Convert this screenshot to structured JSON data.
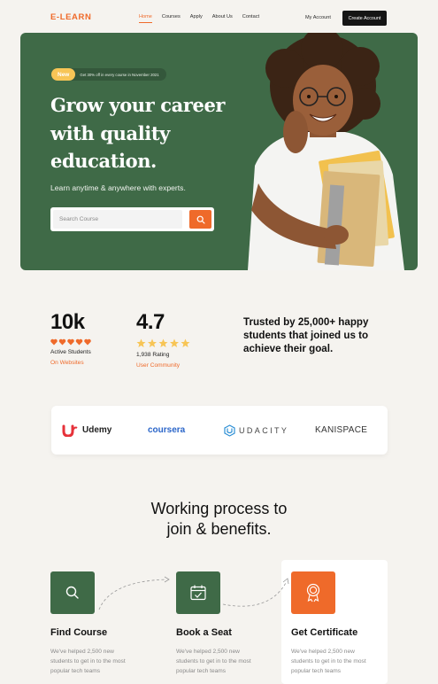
{
  "nav": {
    "logo": "E-LEARN",
    "links": [
      "Home",
      "Courses",
      "Apply",
      "About Us",
      "Contact"
    ],
    "my_account": "My Account",
    "create_account": "Create Account"
  },
  "hero": {
    "promo_badge": "New",
    "promo_text": "Get 30% off in every course in November 2021",
    "title_lines": [
      "Grow your career",
      "with quality",
      "education."
    ],
    "subtitle": "Learn anytime & anywhere with experts.",
    "search_placeholder": "Search Course",
    "background_color": "#3f6a47"
  },
  "stats": [
    {
      "value": "10k",
      "icon": "heart-icon",
      "icon_count": 5,
      "label": "Active Students",
      "source": "On Websites"
    },
    {
      "value": "4.7",
      "icon": "star-icon",
      "icon_count": 5,
      "label": "1,938 Rating",
      "source": "User Community"
    }
  ],
  "trust_text": "Trusted by 25,000+ happy students that joined us to achieve their goal.",
  "partners": [
    "Udemy",
    "coursera",
    "UDACITY",
    "KANISPACE"
  ],
  "process": {
    "title_lines": [
      "Working process to",
      "join & benefits."
    ],
    "steps": [
      {
        "icon": "search-icon",
        "title": "Find Course",
        "description": "We've helped 2,500 new students to get in to the most popular tech teams"
      },
      {
        "icon": "calendar-icon",
        "title": "Book a Seat",
        "description": "We've helped 2,500 new students to get in to the most popular tech teams"
      },
      {
        "icon": "certificate-icon",
        "title": "Get Certificate",
        "description": "We've helped 2,500 new students to get in to the most popular tech teams"
      }
    ]
  },
  "colors": {
    "accent": "#ef6a2a",
    "brand_green": "#3f6a47",
    "rating_star": "#f7c556",
    "background": "#f5f3ef"
  }
}
